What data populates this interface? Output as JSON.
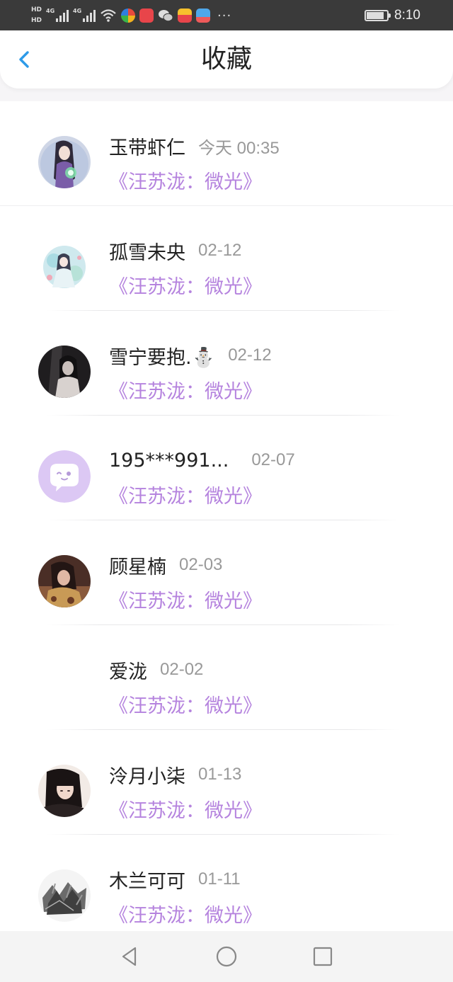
{
  "status_bar": {
    "hd1": "HD",
    "hd2": "HD",
    "net1": "4G",
    "net2": "4G",
    "more": "···",
    "time": "8:10",
    "battery_level": 0.85
  },
  "header": {
    "title": "收藏",
    "back_icon": "chevron-left-icon",
    "accent": "#2d9ae8"
  },
  "list": {
    "book_color": "#b583de",
    "items": [
      {
        "name": "玉带虾仁",
        "date": "今天 00:35",
        "book": "《汪苏泷：微光》"
      },
      {
        "name": "孤雪未央",
        "date": "02-12",
        "book": "《汪苏泷：微光》"
      },
      {
        "name": "雪宁要抱.⛄",
        "date": "02-12",
        "book": "《汪苏泷：微光》"
      },
      {
        "name": "195***991...",
        "date": "02-07",
        "book": "《汪苏泷：微光》"
      },
      {
        "name": "顾星楠",
        "date": "02-03",
        "book": "《汪苏泷：微光》"
      },
      {
        "name": "爱泷",
        "date": "02-02",
        "book": "《汪苏泷：微光》"
      },
      {
        "name": "泠月小柒",
        "date": "01-13",
        "book": "《汪苏泷：微光》"
      },
      {
        "name": "木兰可可",
        "date": "01-11",
        "book": "《汪苏泷：微光》"
      }
    ]
  },
  "nav_bar": {
    "back": "triangle-back-icon",
    "home": "circle-home-icon",
    "recents": "square-recents-icon"
  }
}
